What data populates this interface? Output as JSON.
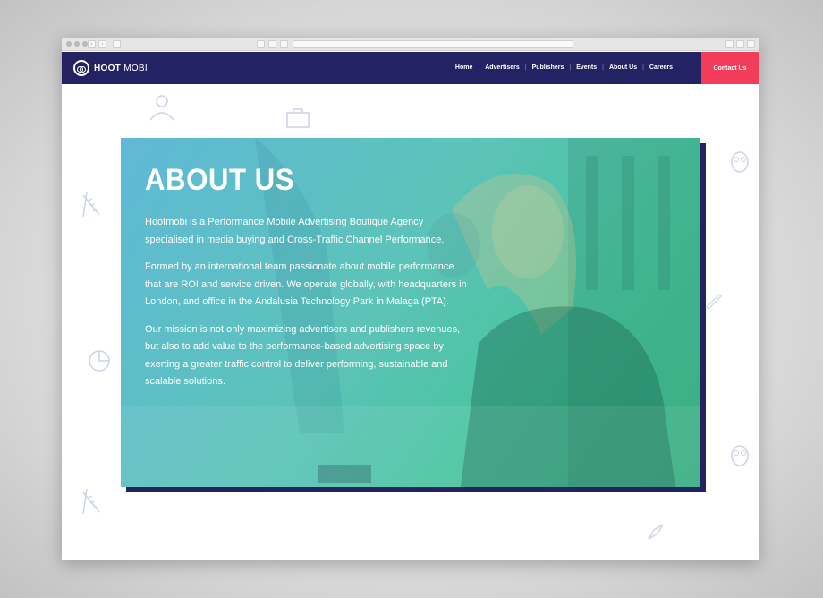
{
  "browser": {
    "chrome_buttons": [
      "back-icon",
      "forward-icon"
    ]
  },
  "nav": {
    "logo_bold": "HOOT",
    "logo_light": "MOBI",
    "items": [
      {
        "label": "Home"
      },
      {
        "label": "Advertisers"
      },
      {
        "label": "Publishers"
      },
      {
        "label": "Events"
      },
      {
        "label": "About Us"
      },
      {
        "label": "Careers"
      }
    ],
    "contact_label": "Contact Us"
  },
  "colors": {
    "nav_bg": "#232363",
    "accent": "#f23c5a",
    "hero_gradient_start": "#5fb9d6",
    "hero_gradient_end": "#3fbe8e"
  },
  "about": {
    "title": "ABOUT US",
    "paragraphs": [
      "Hootmobi is a Performance Mobile Advertising Boutique Agency specialised in media buying and Cross-Traffic Channel Performance.",
      "Formed by an international team passionate about mobile performance that are ROI and service driven. We operate globally, with headquarters in London, and office in the Andalusia Technology Park in Malaga (PTA).",
      "Our mission is not only maximizing advertisers and publishers revenues, but also to add value to the performance-based advertising space by exerting a greater traffic control to deliver performing, sustainable and scalable solutions."
    ]
  }
}
